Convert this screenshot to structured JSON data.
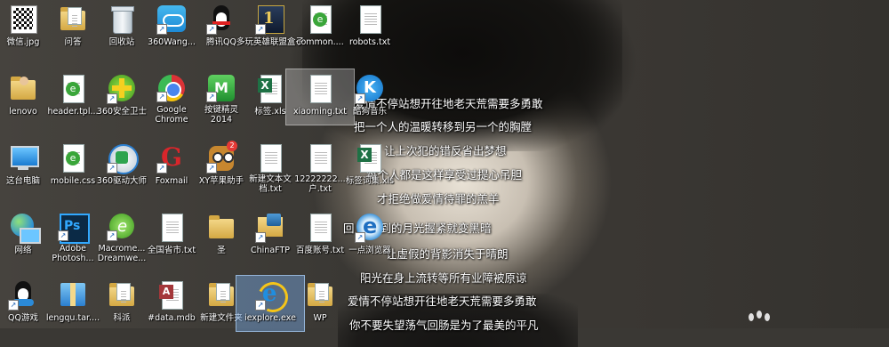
{
  "desktop_icons": [
    {
      "label": "微信.jpg"
    },
    {
      "label": "问答"
    },
    {
      "label": "回收站"
    },
    {
      "label": "360Wang..."
    },
    {
      "label": "腾讯QQ"
    },
    {
      "label": "多玩英雄联盟盒子"
    },
    {
      "label": "common...."
    },
    {
      "label": "robots.txt"
    },
    {
      "label": "lenovo"
    },
    {
      "label": "header.tpl..."
    },
    {
      "label": "360安全卫士"
    },
    {
      "label": "Google Chrome"
    },
    {
      "label": "按键精灵2014"
    },
    {
      "label": "标签.xls"
    },
    {
      "label": "xiaoming.txt"
    },
    {
      "label": "酷狗音乐"
    },
    {
      "label": "这台电脑"
    },
    {
      "label": "mobile.css"
    },
    {
      "label": "360驱动大师"
    },
    {
      "label": "Foxmail"
    },
    {
      "label": "XY苹果助手"
    },
    {
      "label": "新建文本文档.txt"
    },
    {
      "label": "12222222...户.txt"
    },
    {
      "label": "标签词集.xls"
    },
    {
      "label": "网络"
    },
    {
      "label": "Adobe Photosh..."
    },
    {
      "label": "Macrome... Dreamwe..."
    },
    {
      "label": "全国省市.txt"
    },
    {
      "label": "圣"
    },
    {
      "label": "ChinaFTP"
    },
    {
      "label": "百度账号.txt"
    },
    {
      "label": "一点浏览器"
    },
    {
      "label": "QQ游戏"
    },
    {
      "label": "lengqu.tar...."
    },
    {
      "label": "科派"
    },
    {
      "label": "#data.mdb"
    },
    {
      "label": "新建文件夹"
    },
    {
      "label": "iexplore.exe"
    },
    {
      "label": "WP"
    }
  ],
  "badge_count": "2",
  "lyrics": [
    "爱情不停站想开往地老天荒需要多勇敢",
    "把一个人的温暖转移到另一个的胸膛",
    "让上次犯的错反省出梦想",
    "每个人都是这样享受过提心吊胆",
    "才拒绝做爱情待罪的羔羊",
    "回 捉不到的月光握紧就变黑暗",
    "让虚假的背影消失于晴朗",
    "阳光在身上流转等所有业障被原谅",
    "爱情不停站想开往地老天荒需要多勇敢",
    "你不要失望荡气回肠是为了最美的平凡"
  ]
}
